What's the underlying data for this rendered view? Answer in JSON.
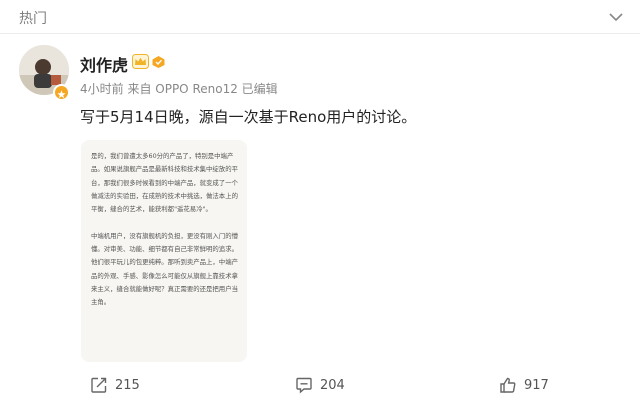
{
  "header": {
    "title": "热门",
    "chevron_icon": "chevron-down-icon"
  },
  "post": {
    "author": {
      "name": "刘作虎",
      "avatar_icon": "avatar-photo",
      "verified_icon": "verified-badge-icon",
      "crown_icon": "crown-badge-icon",
      "level_icon": "level-badge-icon"
    },
    "meta": "4小时前 来自 OPPO Reno12 已编辑",
    "text": "写于5月14日晚，源自一次基于Reno用户的讨论。",
    "image_paragraphs": [
      "是的，我们曾遭太多60分的产品了，特别是中端产品。如果说旗舰产品是最新科技和技术集中绽放的平台，那我们很多时候看到的中端产品，就变成了一个做减法的实验田，在成熟的技术中挑选，做法本上的平衡，缝合的艺术，能获利都\"遥花易冷\"。",
      "中端机用户，没有旗舰机的负担，更没有刚入门的懵懂。对审美、功能、细节都有自己非常鲜明的追求。他们很平玩儿的包更纯粹。那听到卖产品上，中端产品的外观、手感、影像怎么可能仅从旗舰上靠技术拿来主义，缝合就能做好呢？真正需要的还是把用户当主角。"
    ]
  },
  "actions": {
    "repost": {
      "icon": "repost-icon",
      "count": "215"
    },
    "comment": {
      "icon": "comment-icon",
      "count": "204"
    },
    "like": {
      "icon": "thumbs-up-icon",
      "count": "917"
    }
  },
  "colors": {
    "background": "#ffffff",
    "muted_text": "#888888",
    "badge_orange": "#f5a623",
    "crown_gold": "#f0b429"
  }
}
